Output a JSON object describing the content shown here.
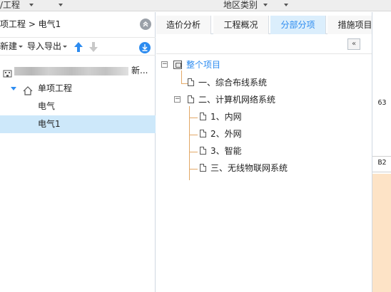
{
  "topbar": {
    "left_label": "/工程",
    "right_label": "地区类别"
  },
  "left_panel": {
    "breadcrumb": "项工程 > 电气1",
    "toolbar": {
      "new_label": "新建",
      "import_export_label": "导入导出"
    },
    "tree": {
      "project_suffix": "新...",
      "group_label": "单项工程",
      "items": [
        "电气",
        "电气1"
      ],
      "selected_item": "电气1"
    }
  },
  "tabs": [
    "造价分析",
    "工程概况",
    "分部分项",
    "措施项目"
  ],
  "active_tab": "分部分项",
  "item_tree": {
    "root": "整个项目",
    "children": [
      {
        "label": "一、综合布线系统"
      },
      {
        "label": "二、计算机网络系统",
        "children": [
          "1、内网",
          "2、外网",
          "3、智能"
        ]
      },
      {
        "label": "三、无线物联网系统"
      }
    ]
  },
  "side_strip": {
    "value_1": "63",
    "value_2": "B2"
  },
  "colors": {
    "accent": "#2d8cf0",
    "selected_row": "#cde8fa",
    "tree_line": "#e3a866",
    "peach": "#fde3c6"
  },
  "icons": [
    "collapse-up-icon",
    "move-up-icon",
    "move-down-icon",
    "download-icon",
    "home-icon",
    "collapse-tree-icon",
    "document-icon",
    "project-icon"
  ]
}
